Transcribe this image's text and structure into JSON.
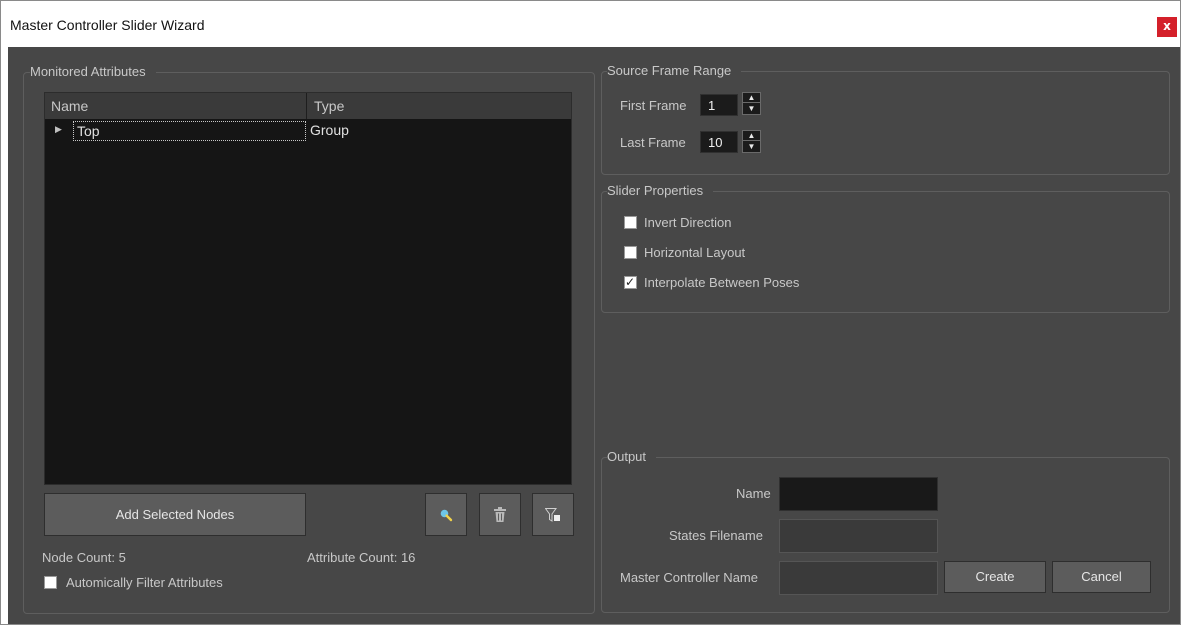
{
  "window": {
    "title": "Master Controller Slider Wizard",
    "close_label": "x"
  },
  "monitored": {
    "group_title": "Monitored Attributes",
    "columns": [
      "Name",
      "Type"
    ],
    "rows": [
      {
        "name": "Top",
        "type": "Group"
      }
    ],
    "add_button": "Add Selected Nodes",
    "node_count": "Node Count: 5",
    "attribute_count": "Attribute Count: 16",
    "auto_filter_label": "Automically Filter Attributes",
    "auto_filter_checked": false,
    "icons": [
      "select-icon",
      "trash-icon",
      "filter-icon"
    ]
  },
  "source_range": {
    "group_title": "Source Frame Range",
    "first_label": "First Frame",
    "first_value": "1",
    "last_label": "Last Frame",
    "last_value": "10"
  },
  "slider_props": {
    "group_title": "Slider Properties",
    "options": [
      {
        "label": "Invert Direction",
        "checked": false
      },
      {
        "label": "Horizontal Layout",
        "checked": false
      },
      {
        "label": "Interpolate Between Poses",
        "checked": true
      }
    ]
  },
  "output": {
    "group_title": "Output",
    "name_label": "Name",
    "name_value": "",
    "states_label": "States Filename",
    "states_value": "",
    "master_label": "Master Controller Name",
    "master_value": "",
    "create_button": "Create",
    "cancel_button": "Cancel"
  },
  "colors": {
    "client_bg": "#474747",
    "tree_bg": "#151515",
    "close_bg": "#d4202a",
    "text": "#c8c8c8"
  }
}
